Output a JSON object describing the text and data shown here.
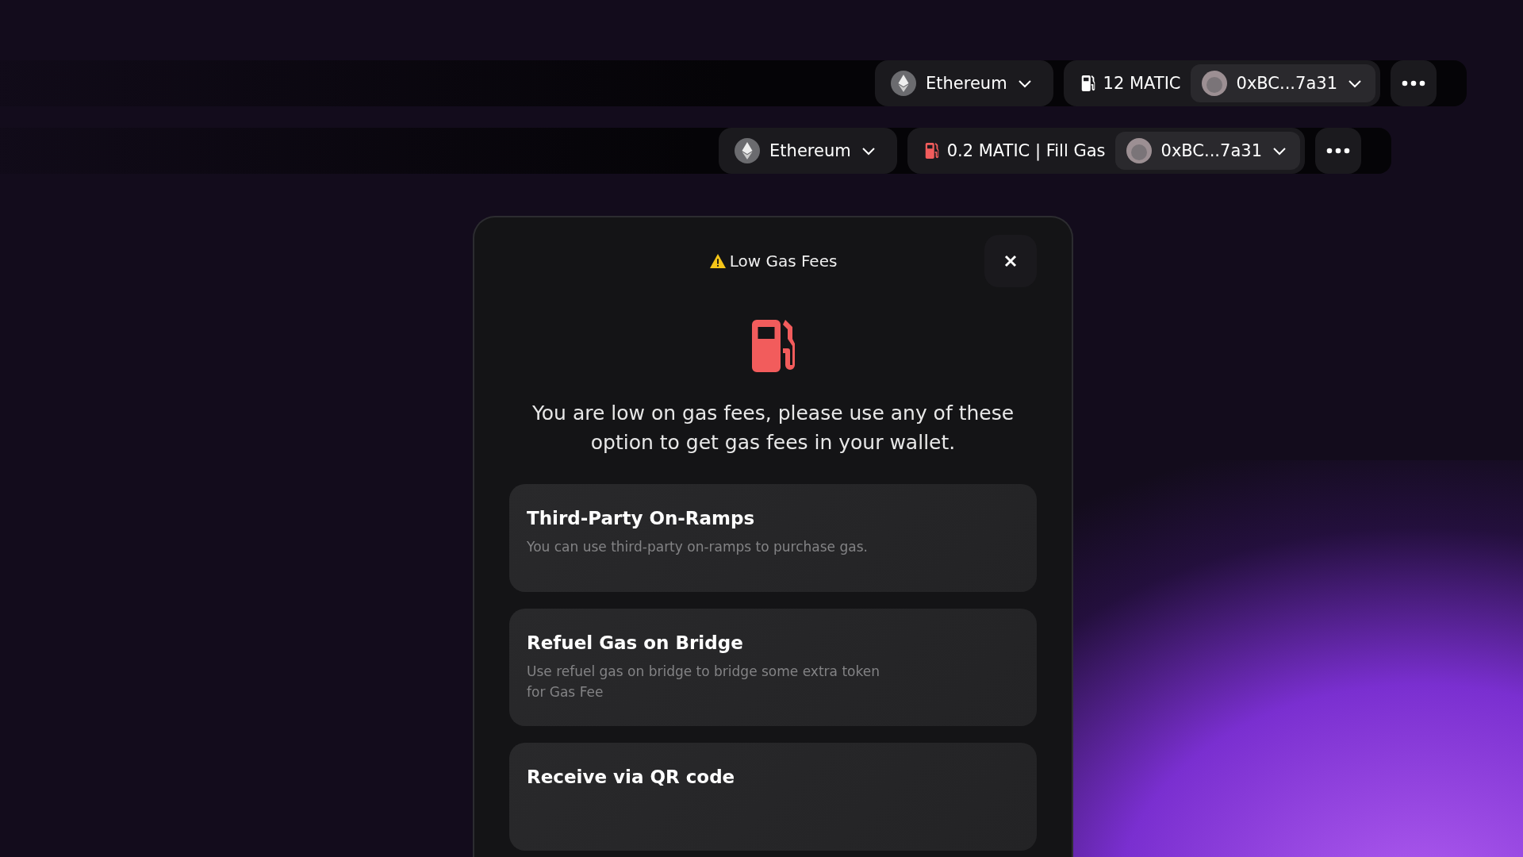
{
  "toolbars": [
    {
      "network": "Ethereum",
      "balance": {
        "text": "12 MATIC",
        "low": false
      },
      "wallet": "0xBC...7a31"
    },
    {
      "network": "Ethereum",
      "balance": {
        "text": "0.2 MATIC | Fill Gas",
        "low": true
      },
      "wallet": "0xBC...7a31"
    }
  ],
  "modal": {
    "title": "Low Gas Fees",
    "message": "You are low on gas fees, please use any of these option to get gas fees in your wallet.",
    "options": [
      {
        "title": "Third-Party On-Ramps",
        "description": "You can use third-party on-ramps to purchase gas."
      },
      {
        "title": "Refuel Gas on Bridge",
        "description": "Use refuel gas on bridge to bridge some extra token for Gas Fee"
      },
      {
        "title": "Receive via QR code"
      }
    ]
  }
}
